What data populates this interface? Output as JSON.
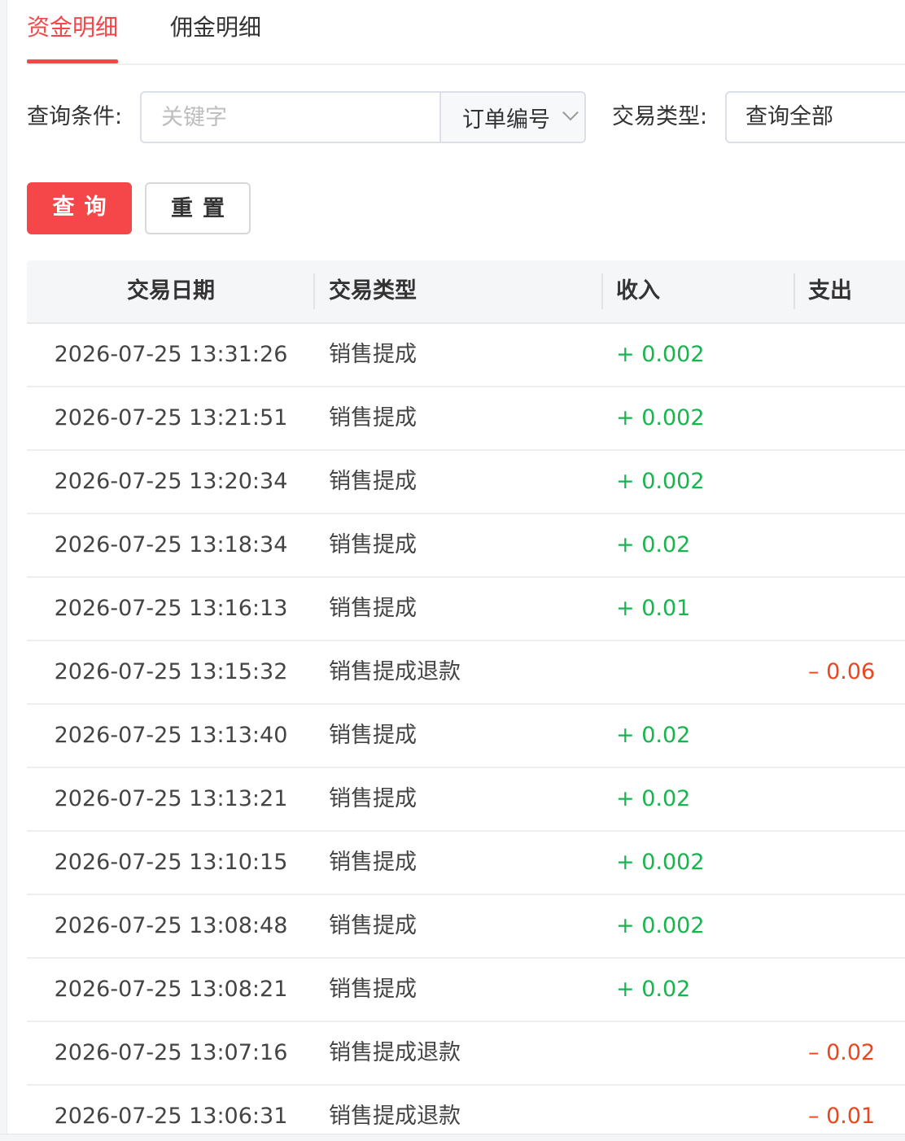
{
  "tabs": [
    {
      "label": "资金明细",
      "active": true
    },
    {
      "label": "佣金明细",
      "active": false
    }
  ],
  "filters": {
    "query_label": "查询条件:",
    "keyword_placeholder": "关键字",
    "field_select_value": "订单编号",
    "type_label": "交易类型:",
    "type_select_value": "查询全部"
  },
  "buttons": {
    "search_label": "查询",
    "reset_label": "重置"
  },
  "table": {
    "headers": [
      "交易日期",
      "交易类型",
      "收入",
      "支出"
    ],
    "rows": [
      {
        "date": "2026-07-25 13:31:26",
        "type": "销售提成",
        "income": "+ 0.002",
        "expense": ""
      },
      {
        "date": "2026-07-25 13:21:51",
        "type": "销售提成",
        "income": "+ 0.002",
        "expense": ""
      },
      {
        "date": "2026-07-25 13:20:34",
        "type": "销售提成",
        "income": "+ 0.002",
        "expense": ""
      },
      {
        "date": "2026-07-25 13:18:34",
        "type": "销售提成",
        "income": "+ 0.02",
        "expense": ""
      },
      {
        "date": "2026-07-25 13:16:13",
        "type": "销售提成",
        "income": "+ 0.01",
        "expense": ""
      },
      {
        "date": "2026-07-25 13:15:32",
        "type": "销售提成退款",
        "income": "",
        "expense": "– 0.06"
      },
      {
        "date": "2026-07-25 13:13:40",
        "type": "销售提成",
        "income": "+ 0.02",
        "expense": ""
      },
      {
        "date": "2026-07-25 13:13:21",
        "type": "销售提成",
        "income": "+ 0.02",
        "expense": ""
      },
      {
        "date": "2026-07-25 13:10:15",
        "type": "销售提成",
        "income": "+ 0.002",
        "expense": ""
      },
      {
        "date": "2026-07-25 13:08:48",
        "type": "销售提成",
        "income": "+ 0.002",
        "expense": ""
      },
      {
        "date": "2026-07-25 13:08:21",
        "type": "销售提成",
        "income": "+ 0.02",
        "expense": ""
      },
      {
        "date": "2026-07-25 13:07:16",
        "type": "销售提成退款",
        "income": "",
        "expense": "– 0.02"
      },
      {
        "date": "2026-07-25 13:06:31",
        "type": "销售提成退款",
        "income": "",
        "expense": "– 0.01"
      }
    ]
  },
  "colors": {
    "accent": "#f5474a",
    "income": "#19b34f",
    "expense": "#e8471f"
  }
}
